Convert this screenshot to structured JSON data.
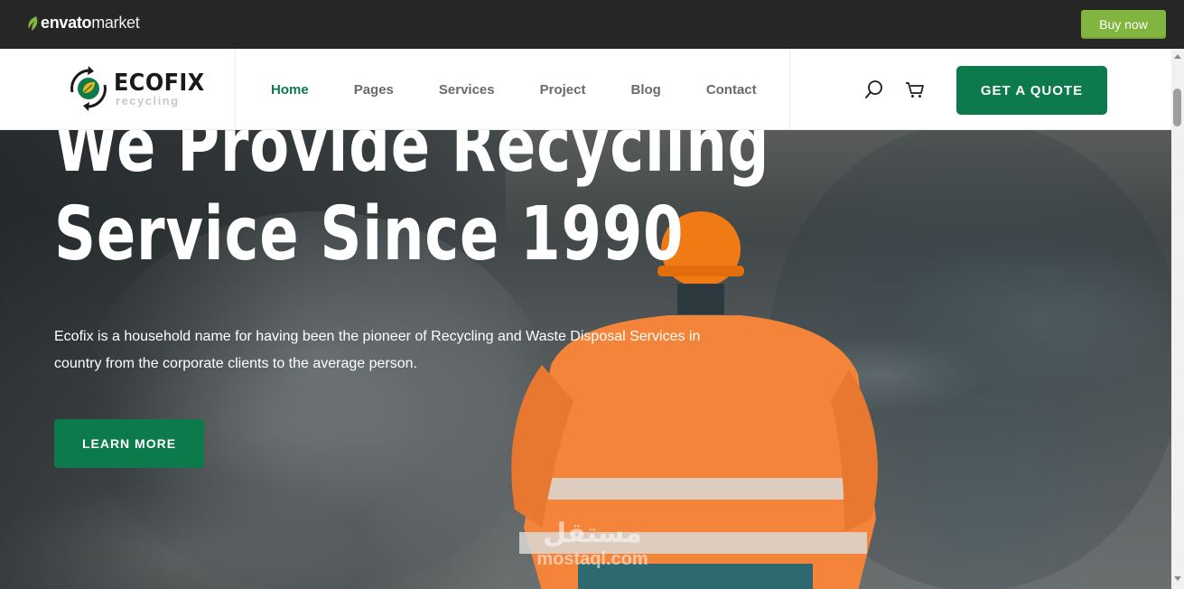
{
  "envato": {
    "logo_brand": "envato",
    "logo_market": "market",
    "buy_label": "Buy now"
  },
  "header": {
    "logo_name": "ECOFIX",
    "logo_sub": "recycling",
    "nav": [
      {
        "label": "Home",
        "active": true
      },
      {
        "label": "Pages",
        "active": false
      },
      {
        "label": "Services",
        "active": false
      },
      {
        "label": "Project",
        "active": false
      },
      {
        "label": "Blog",
        "active": false
      },
      {
        "label": "Contact",
        "active": false
      }
    ],
    "search_icon": "search-icon",
    "cart_icon": "cart-icon",
    "quote_label": "GET A QUOTE"
  },
  "hero": {
    "line1": "We Provide Recycling",
    "line2": "Service Since 1990",
    "description": "Ecofix is a household name for having been the pioneer of Recycling and Waste Disposal Services in country from the corporate clients to the average person.",
    "cta_label": "LEARN MORE"
  },
  "watermark": {
    "arabic": "مستقل",
    "latin": "mostaql.com"
  },
  "colors": {
    "brand_green": "#0c7a4b",
    "envato_green": "#82b440",
    "topbar": "#262626"
  }
}
